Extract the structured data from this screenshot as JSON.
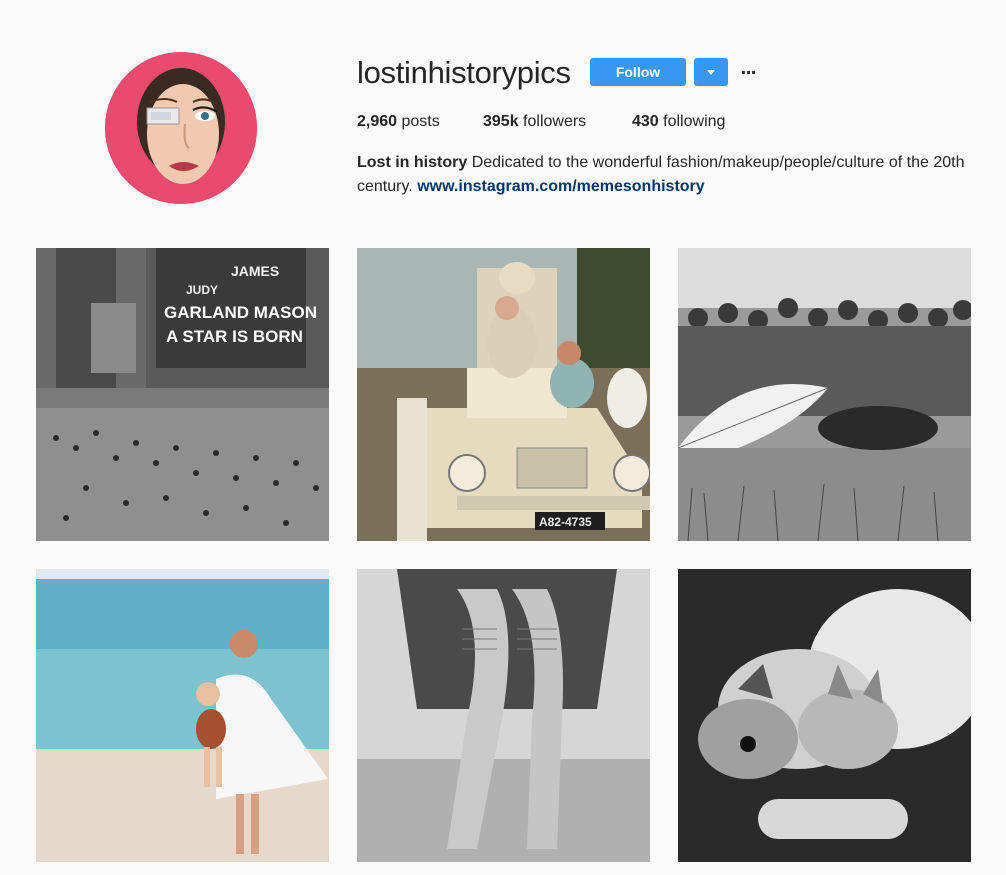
{
  "profile": {
    "username": "lostinhistorypics",
    "avatar_icon": "profile-avatar",
    "follow_label": "Follow",
    "more_label": "···",
    "accent_color": "#3897f0",
    "avatar_bg_color": "#e94a6e"
  },
  "stats": {
    "posts_count": "2,960",
    "posts_label": "posts",
    "followers_count": "395k",
    "followers_label": "followers",
    "following_count": "430",
    "following_label": "following"
  },
  "bio": {
    "name": "Lost in history",
    "text": "Dedicated to the wonderful fashion/makeup/people/culture of the 20th century.",
    "link": "www.instagram.com/memesonhistory"
  },
  "posts": [
    {
      "marquee_line1": "JUDY",
      "marquee_line2": "JAMES",
      "marquee_line3": "GARLAND MASON",
      "marquee_line4": "A STAR IS BORN",
      "plate": ""
    },
    {
      "plate": "A82-4735"
    },
    {
      "plate": ""
    },
    {
      "plate": ""
    },
    {
      "plate": ""
    },
    {
      "plate": ""
    }
  ]
}
